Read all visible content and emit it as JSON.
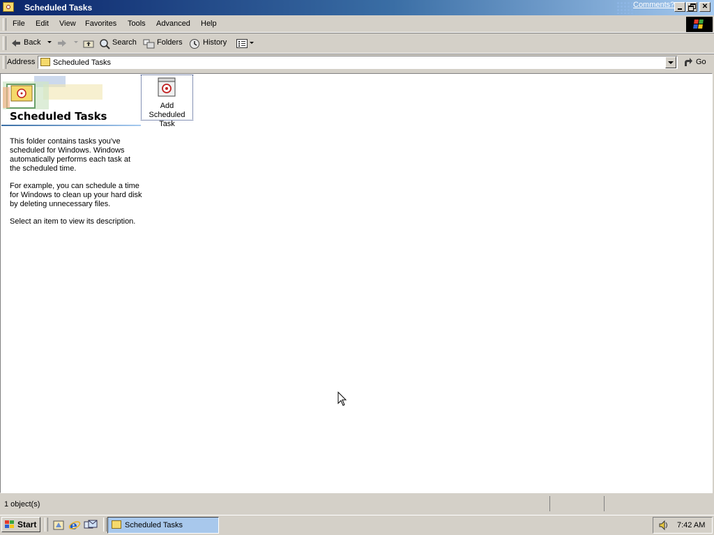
{
  "window": {
    "title": "Scheduled Tasks",
    "comments_link": "Comments?"
  },
  "menu": {
    "items": [
      "File",
      "Edit",
      "View",
      "Favorites",
      "Tools",
      "Advanced",
      "Help"
    ]
  },
  "toolbar": {
    "back_label": "Back",
    "search_label": "Search",
    "folders_label": "Folders",
    "history_label": "History"
  },
  "address": {
    "label": "Address",
    "value": "Scheduled Tasks",
    "go_label": "Go"
  },
  "sidepanel": {
    "heading": "Scheduled Tasks",
    "paragraphs": [
      "This folder contains tasks you've scheduled for Windows. Windows automatically performs each task at the scheduled time.",
      "For example, you can schedule a time for Windows to clean up your hard disk by deleting unnecessary files.",
      "Select an item to view its description."
    ]
  },
  "items": [
    {
      "label": "Add Scheduled Task"
    }
  ],
  "status": {
    "text": "1 object(s)"
  },
  "taskbar": {
    "start_label": "Start",
    "window_button": "Scheduled Tasks",
    "clock": "7:42 AM"
  },
  "colors": {
    "titlebar_start": "#0a246a",
    "titlebar_end": "#a6caf0",
    "face": "#d4d0c8",
    "selected_task": "#a8c8ec"
  }
}
